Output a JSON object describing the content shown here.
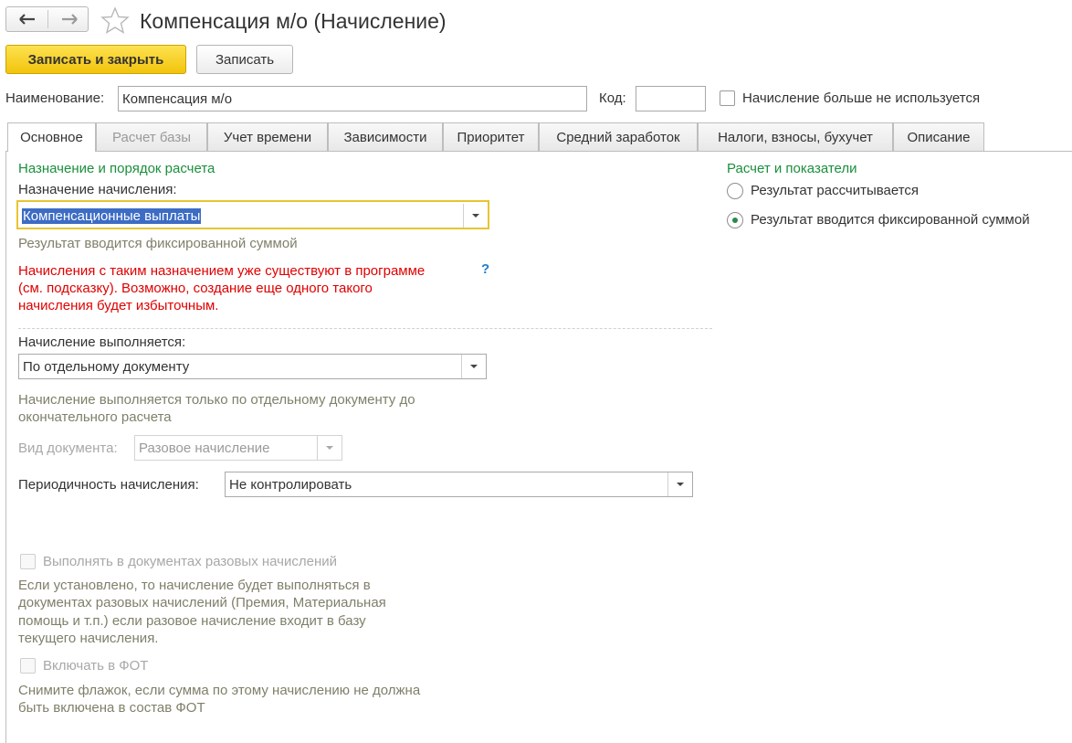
{
  "header": {
    "back_icon": "arrow-left-icon",
    "forward_icon": "arrow-right-icon",
    "favorite_icon": "star-icon",
    "title": "Компенсация м/о (Начисление)"
  },
  "toolbar": {
    "save_close_label": "Записать и закрыть",
    "save_label": "Записать"
  },
  "fields": {
    "name_label": "Наименование:",
    "name_value": "Компенсация м/о",
    "code_label": "Код:",
    "code_value": "",
    "unused_label": "Начисление больше не используется"
  },
  "tabs": [
    {
      "label": "Основное"
    },
    {
      "label": "Расчет базы"
    },
    {
      "label": "Учет времени"
    },
    {
      "label": "Зависимости"
    },
    {
      "label": "Приоритет"
    },
    {
      "label": "Средний заработок"
    },
    {
      "label": "Налоги, взносы, бухучет"
    },
    {
      "label": "Описание"
    }
  ],
  "main": {
    "purpose_section_title": "Назначение и порядок расчета",
    "purpose_label": "Назначение начисления:",
    "purpose_value": "Компенсационные выплаты",
    "purpose_hint": "Результат вводится фиксированной суммой",
    "warning_lines": [
      "Начисления с таким назначением уже существуют в программе",
      "(см. подсказку). Возможно, создание еще одного такого",
      "начисления будет избыточным."
    ],
    "help_mark": "?",
    "performed_label": "Начисление выполняется:",
    "performed_value": "По отдельному документу",
    "performed_hint_lines": [
      "Начисление выполняется только по отдельному документу до",
      "окончательного расчета"
    ],
    "doc_type_label": "Вид документа:",
    "doc_type_value": "Разовое начисление",
    "periodicity_label": "Периодичность начисления:",
    "periodicity_value": "Не контролировать",
    "one_time_checkbox_label": "Выполнять в документах разовых начислений",
    "one_time_hint_lines": [
      "Если установлено, то начисление будет выполняться в",
      "документах разовых начислений (Премия, Материальная",
      "помощь и т.п.) если разовое начисление входит в базу",
      "текущего начисления."
    ],
    "fot_checkbox_label": "Включать в ФОТ",
    "fot_hint_lines": [
      "Снимите флажок, если сумма по этому начислению не должна",
      "быть включена в состав ФОТ"
    ]
  },
  "calc": {
    "section_title": "Расчет и показатели",
    "radio_calculated": "Результат рассчитывается",
    "radio_fixed": "Результат вводится фиксированной суммой",
    "selected": "fixed"
  },
  "colors": {
    "accent_yellow": "#f5cc1e",
    "section_green": "#1a8f3c",
    "warning_red": "#e00000",
    "help_blue": "#1f7ed0"
  }
}
